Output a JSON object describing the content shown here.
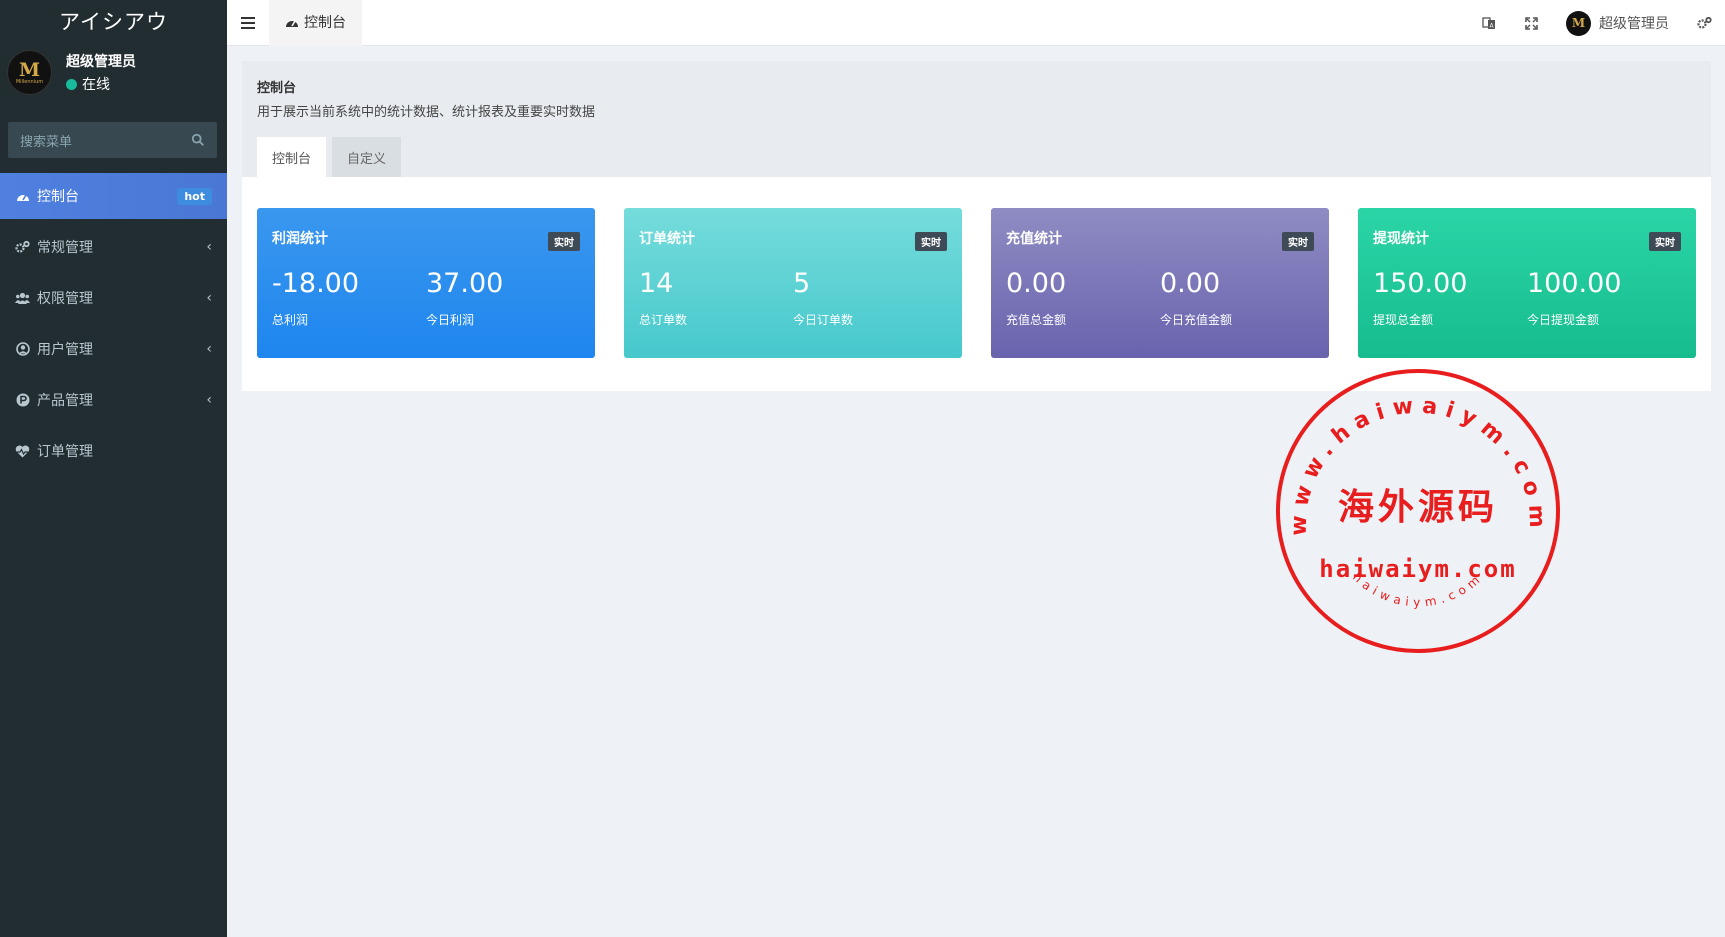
{
  "sidebar": {
    "logo": "アイシアウ",
    "user_name": "超级管理员",
    "user_status": "在线",
    "search_placeholder": "搜索菜单",
    "items": [
      {
        "label": "控制台",
        "badge": "hot"
      },
      {
        "label": "常规管理"
      },
      {
        "label": "权限管理"
      },
      {
        "label": "用户管理"
      },
      {
        "label": "产品管理"
      },
      {
        "label": "订单管理"
      }
    ]
  },
  "topbar": {
    "tab_label": "控制台",
    "user_name": "超级管理员",
    "avatar_letter": "M"
  },
  "panel": {
    "title": "控制台",
    "description": "用于展示当前系统中的统计数据、统计报表及重要实时数据",
    "tabs": [
      "控制台",
      "自定义"
    ]
  },
  "cards": [
    {
      "title": "利润统计",
      "badge": "实时",
      "stats": [
        {
          "value": "-18.00",
          "label": "总利润"
        },
        {
          "value": "37.00",
          "label": "今日利润"
        }
      ]
    },
    {
      "title": "订单统计",
      "badge": "实时",
      "stats": [
        {
          "value": "14",
          "label": "总订单数"
        },
        {
          "value": "5",
          "label": "今日订单数"
        }
      ]
    },
    {
      "title": "充值统计",
      "badge": "实时",
      "stats": [
        {
          "value": "0.00",
          "label": "充值总金额"
        },
        {
          "value": "0.00",
          "label": "今日充值金额"
        }
      ]
    },
    {
      "title": "提现统计",
      "badge": "实时",
      "stats": [
        {
          "value": "150.00",
          "label": "提现总金额"
        },
        {
          "value": "100.00",
          "label": "今日提现金额"
        }
      ]
    }
  ],
  "watermark": {
    "ring_text": "www.haiwaiym.com",
    "center_text": "海外源码",
    "domain_text": "haiwaiym.com",
    "small_text": "haiwaiym.com",
    "color": "#e81d1d"
  },
  "avatar_text": {
    "letter": "M",
    "word": "Millennium"
  }
}
